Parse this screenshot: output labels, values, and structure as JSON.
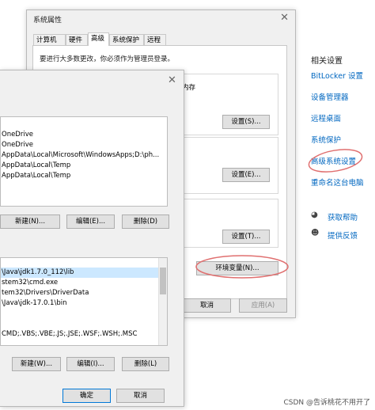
{
  "system_properties": {
    "title": "系统属性",
    "tabs": [
      "计算机名",
      "硬件",
      "高级",
      "系统保护",
      "远程"
    ],
    "admin_note": "要进行大多数更改，你必须作为管理员登录。",
    "perf_suffix": "内存",
    "settings_label_1": "设置(S)...",
    "settings_label_2": "设置(E)...",
    "settings_label_3": "设置(T)...",
    "env_button": "环境变量(N)...",
    "cancel": "取消",
    "apply": "应用(A)"
  },
  "env_dialog": {
    "user_vars": [
      "OneDrive",
      "OneDrive",
      "AppData\\Local\\Microsoft\\WindowsApps;D:\\ph...",
      "AppData\\Local\\Temp",
      "AppData\\Local\\Temp"
    ],
    "user_new": "新建(N)...",
    "user_edit": "编辑(E)...",
    "user_delete": "删除(D)",
    "sys_vars": [
      "\\Java\\jdk1.7.0_112\\lib",
      "stem32\\cmd.exe",
      "tem32\\Drivers\\DriverData",
      "\\Java\\jdk-17.0.1\\bin",
      "",
      "",
      "CMD;.VBS;.VBE;.JS;.JSE;.WSF;.WSH;.MSC"
    ],
    "sys_new": "新建(W)...",
    "sys_edit": "编辑(I)...",
    "sys_delete": "删除(L)",
    "ok": "确定",
    "cancel": "取消"
  },
  "related": {
    "title": "相关设置",
    "links": [
      "BitLocker 设置",
      "设备管理器",
      "远程桌面",
      "系统保护",
      "高级系统设置",
      "重命名这台电脑"
    ],
    "help": "获取帮助",
    "feedback": "提供反馈"
  },
  "watermark": "CSDN @告诉桃花不用开了"
}
